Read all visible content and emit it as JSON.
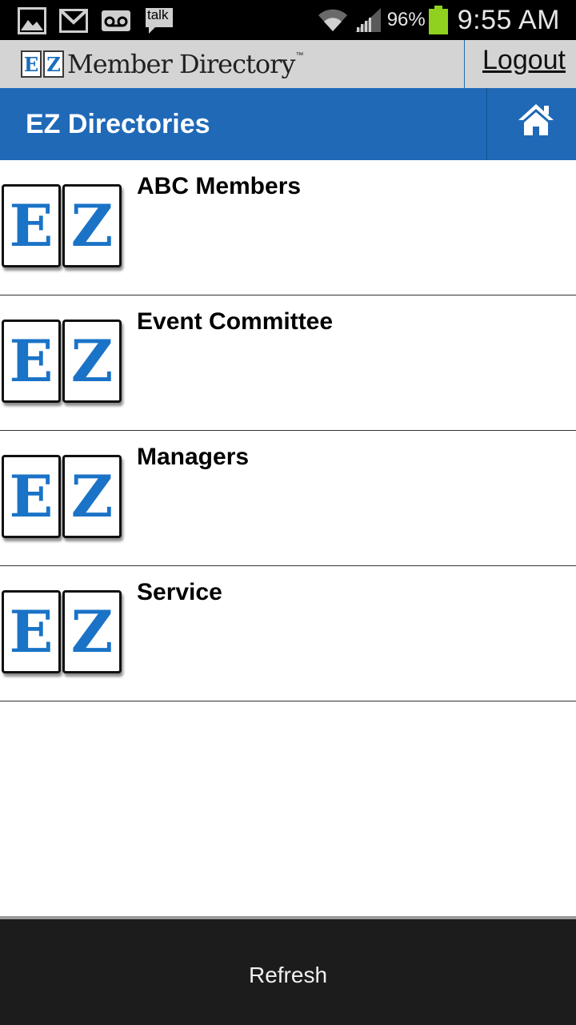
{
  "status_bar": {
    "notification_icons": [
      "gallery-icon",
      "gmail-icon",
      "voicemail-icon",
      "talk-icon"
    ],
    "talk_label": "talk",
    "battery_percent": "96%",
    "time": "9:55 AM",
    "battery_color": "#8fd11e"
  },
  "header": {
    "logo_letters": [
      "E",
      "Z"
    ],
    "logo_text": "Member Directory",
    "logo_tm": "™",
    "logout_label": "Logout"
  },
  "titlebar": {
    "title": "EZ Directories",
    "home_icon": "home-icon"
  },
  "directories": [
    {
      "label": "ABC Members",
      "icon_letters": [
        "E",
        "Z"
      ]
    },
    {
      "label": "Event Committee",
      "icon_letters": [
        "E",
        "Z"
      ]
    },
    {
      "label": "Managers",
      "icon_letters": [
        "E",
        "Z"
      ]
    },
    {
      "label": "Service",
      "icon_letters": [
        "E",
        "Z"
      ]
    }
  ],
  "footer": {
    "refresh_label": "Refresh"
  },
  "colors": {
    "accent": "#1f69b7",
    "header_bg": "#d4d4d4",
    "footer_bg": "#1c1c1c"
  }
}
